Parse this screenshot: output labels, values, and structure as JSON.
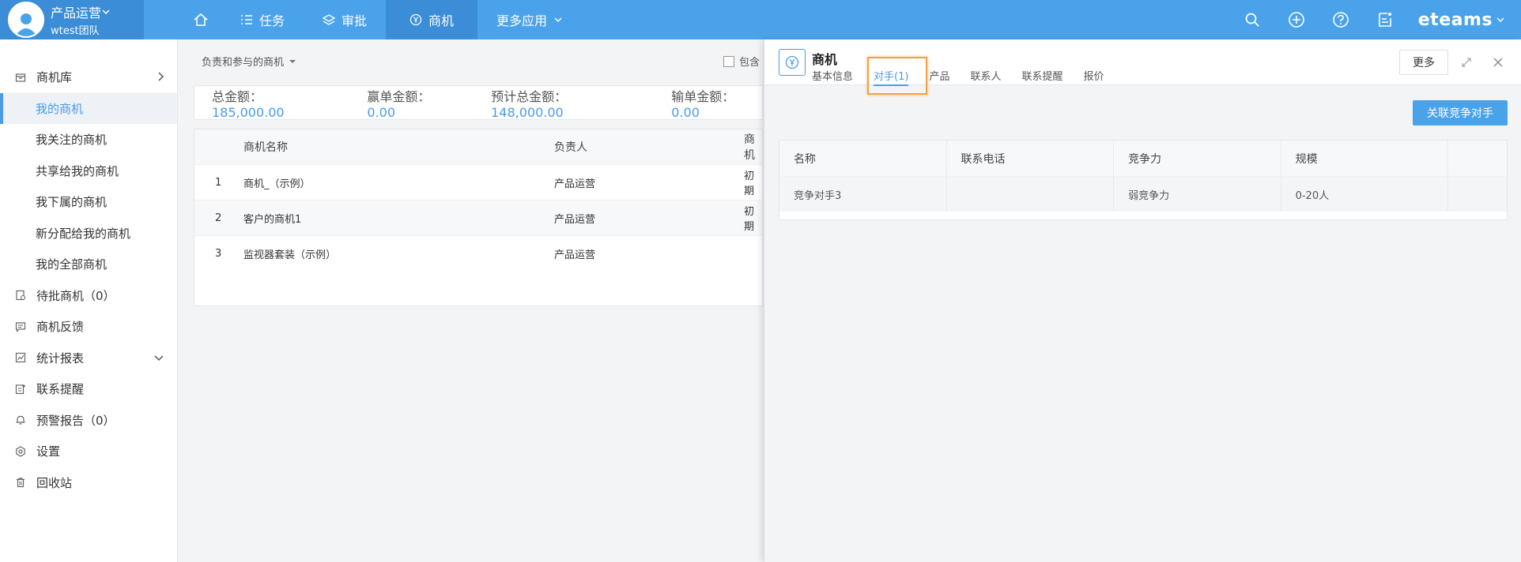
{
  "user": {
    "name": "产品运营",
    "team": "wtest团队"
  },
  "nav": {
    "items": [
      {
        "label": "任务"
      },
      {
        "label": "审批"
      },
      {
        "label": "商机"
      },
      {
        "label": "更多应用"
      }
    ],
    "brand": "eteams"
  },
  "sidebar": {
    "items": [
      {
        "label": "商机库"
      },
      {
        "label": "我的商机"
      },
      {
        "label": "我关注的商机"
      },
      {
        "label": "共享给我的商机"
      },
      {
        "label": "我下属的商机"
      },
      {
        "label": "新分配给我的商机"
      },
      {
        "label": "我的全部商机"
      },
      {
        "label": "待批商机（0）"
      },
      {
        "label": "商机反馈"
      },
      {
        "label": "统计报表"
      },
      {
        "label": "联系提醒"
      },
      {
        "label": "预警报告（0）"
      },
      {
        "label": "设置"
      },
      {
        "label": "回收站"
      }
    ]
  },
  "main": {
    "filter_label": "负责和参与的商机",
    "include_label": "包含",
    "summary": [
      {
        "label": "总金额：",
        "value": "185,000.00"
      },
      {
        "label": "赢单金额：",
        "value": "0.00"
      },
      {
        "label": "预计总金额：",
        "value": "148,000.00"
      },
      {
        "label": "输单金额：",
        "value": "0.00"
      }
    ],
    "table": {
      "headers": {
        "name": "商机名称",
        "owner": "负责人",
        "stage": "商机"
      },
      "rows": [
        {
          "index": "1",
          "name": "商机_（示例）",
          "owner": "产品运营",
          "stage": "初期"
        },
        {
          "index": "2",
          "name": "客户的商机1",
          "owner": "产品运营",
          "stage": "初期"
        },
        {
          "index": "3",
          "name": "监视器套装（示例）",
          "owner": "产品运营",
          "stage": ""
        }
      ]
    }
  },
  "panel": {
    "title": "商机",
    "tabs": [
      {
        "label": "基本信息"
      },
      {
        "label": "对手(1)"
      },
      {
        "label": "产品"
      },
      {
        "label": "联系人"
      },
      {
        "label": "联系提醒"
      },
      {
        "label": "报价"
      }
    ],
    "more_label": "更多",
    "link_competitor_label": "关联竞争对手",
    "table": {
      "headers": [
        "名称",
        "联系电话",
        "竞争力",
        "规模"
      ],
      "rows": [
        [
          "竞争对手3",
          "",
          "弱竞争力",
          "0-20人"
        ]
      ]
    }
  }
}
